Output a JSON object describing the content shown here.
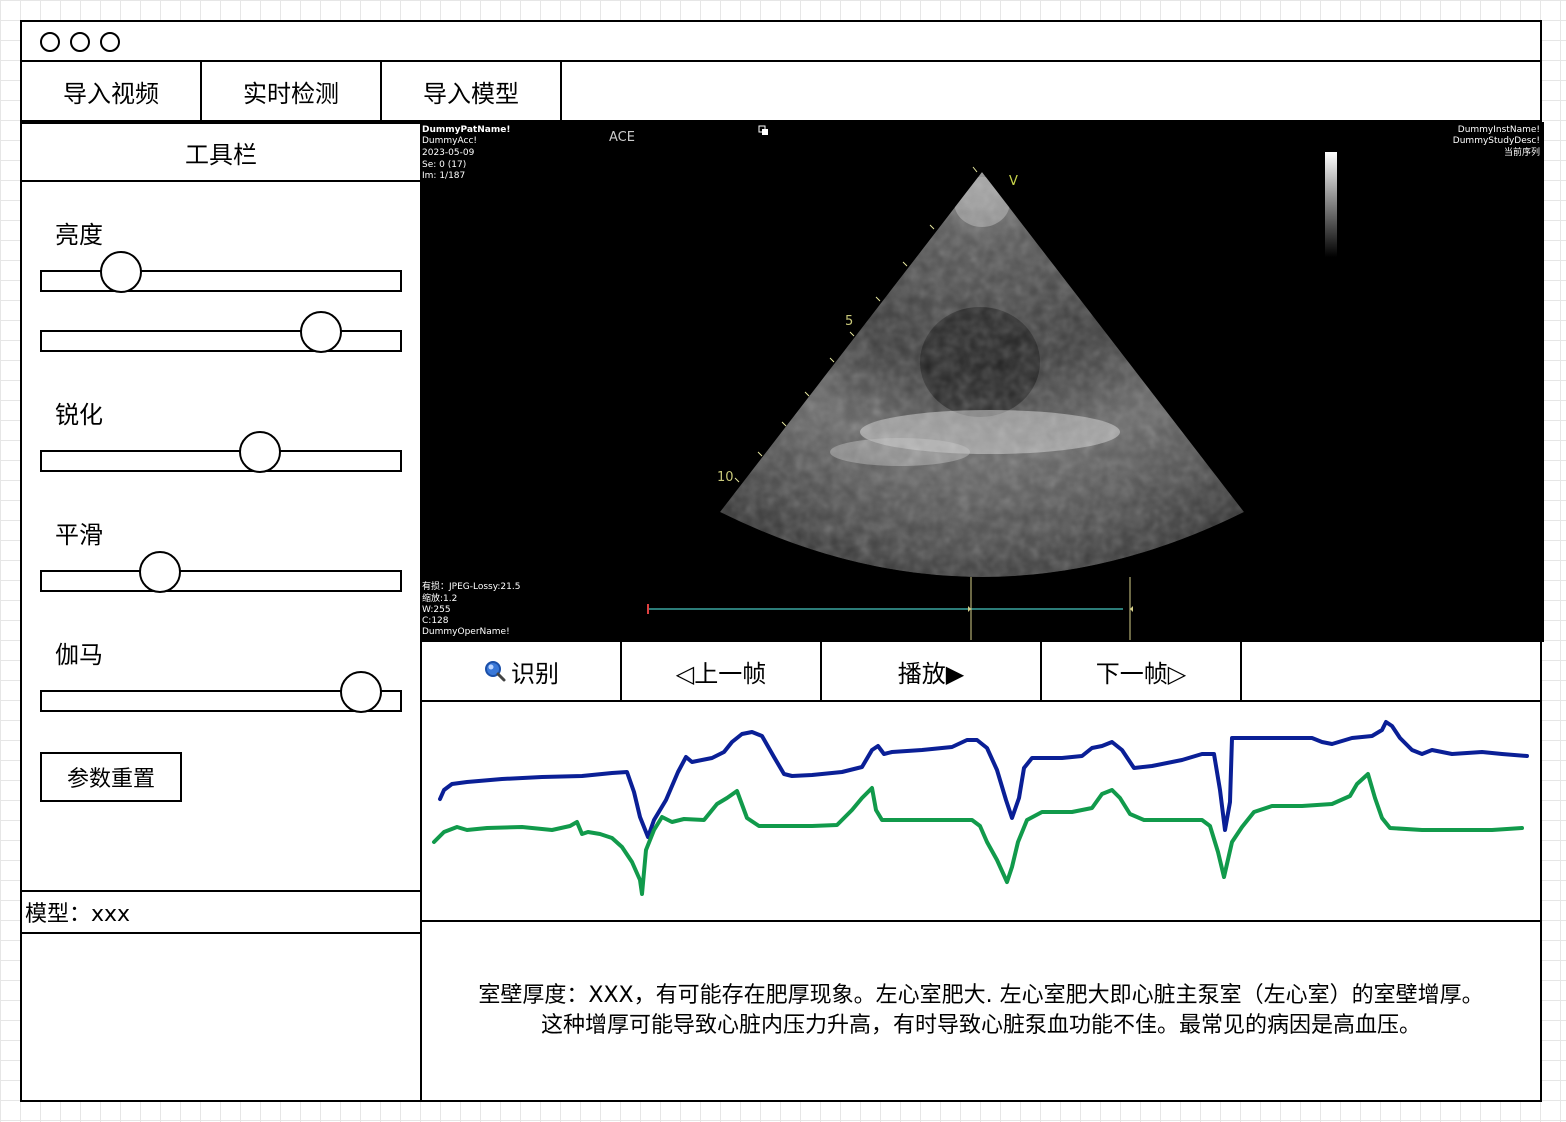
{
  "window": {
    "controls": [
      "circle",
      "circle",
      "circle"
    ]
  },
  "menu": {
    "items": [
      "导入视频",
      "实时检测",
      "导入模型"
    ]
  },
  "toolbar": {
    "title": "工具栏",
    "brightness_label": "亮度",
    "sharpen_label": "锐化",
    "smooth_label": "平滑",
    "gamma_label": "伽马",
    "sliders": [
      0.22,
      0.78,
      0.61,
      0.33,
      0.89
    ],
    "reset_label": "参数重置"
  },
  "model": {
    "label": "模型：xxx"
  },
  "viewer": {
    "patient_name": "DummyPatName!",
    "accession": "DummyAcc!",
    "date": "2023-05-09",
    "series": "Se: 0 (17)",
    "image": "Im: 1/187",
    "mode_label": "ACE",
    "inst_name": "DummyInstName!",
    "study_desc": "DummyStudyDesc!",
    "current_series": "当前序列",
    "v_marker": "V",
    "depth_5": "5",
    "depth_10": "10",
    "info_compress": "有损：JPEG-Lossy:21.5",
    "info_zoom": "缩放:1.2",
    "info_w": "W:255",
    "info_c": "C:128",
    "info_oper": "DummyOperName!"
  },
  "controls": {
    "identify_icon": "magnifier-icon",
    "identify": "识别",
    "prev": "◁上一帧",
    "play": "播放▶",
    "next": "下一帧▷"
  },
  "result": {
    "line1": "室壁厚度：XXX，有可能存在肥厚现象。左心室肥大. 左心室肥大即心脏主泵室（左心室）的室壁增厚。",
    "line2": "这种增厚可能导致心脏内压力升高，有时导致心脏泵血功能不佳。最常见的病因是高血压。"
  },
  "colors": {
    "wave_blue": "#0a1f96",
    "wave_green": "#119a4b",
    "timeline": "#3aa6a0"
  }
}
